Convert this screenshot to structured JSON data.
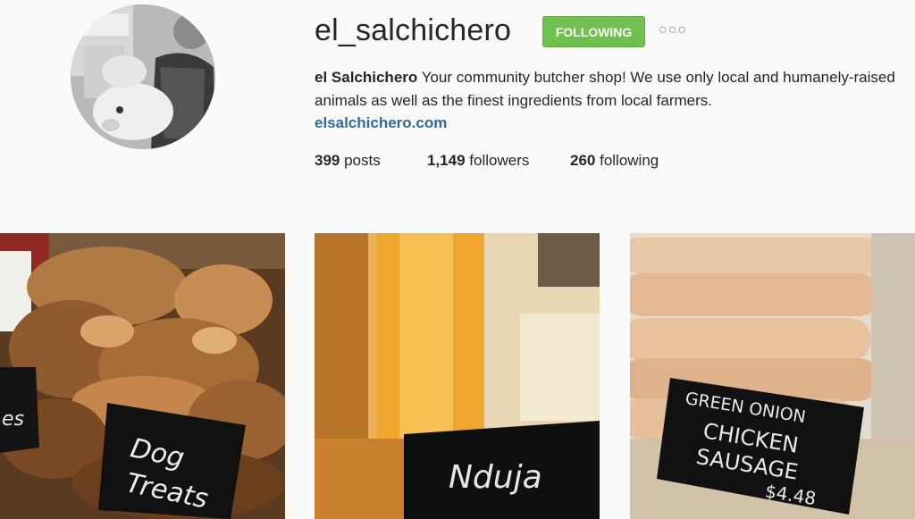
{
  "profile": {
    "username": "el_salchichero",
    "follow_label": "FOLLOWING",
    "options_icon": "more-options-icon",
    "bio_name": "el Salchichero",
    "bio_text": " Your community butcher shop! We use only local and humanely-raised animals as well as the finest ingredients from local farmers.",
    "website": "elsalchichero.com"
  },
  "stats": {
    "posts_count": "399",
    "posts_label": " posts",
    "followers_count": "1,149",
    "followers_label": " followers",
    "following_count": "260",
    "following_label": " following"
  },
  "posts": [
    {
      "sign_line1": "Dog",
      "sign_line2": "Treats",
      "side_text": "es"
    },
    {
      "sign_text": "Nduja"
    },
    {
      "sign_line1": "GREEN ONION",
      "sign_line2": "CHICKEN",
      "sign_line3": "SAUSAGE",
      "price": "$4.48"
    }
  ],
  "colors": {
    "follow_button": "#70c050",
    "link": "#2f6b99",
    "background": "#fafafa"
  }
}
